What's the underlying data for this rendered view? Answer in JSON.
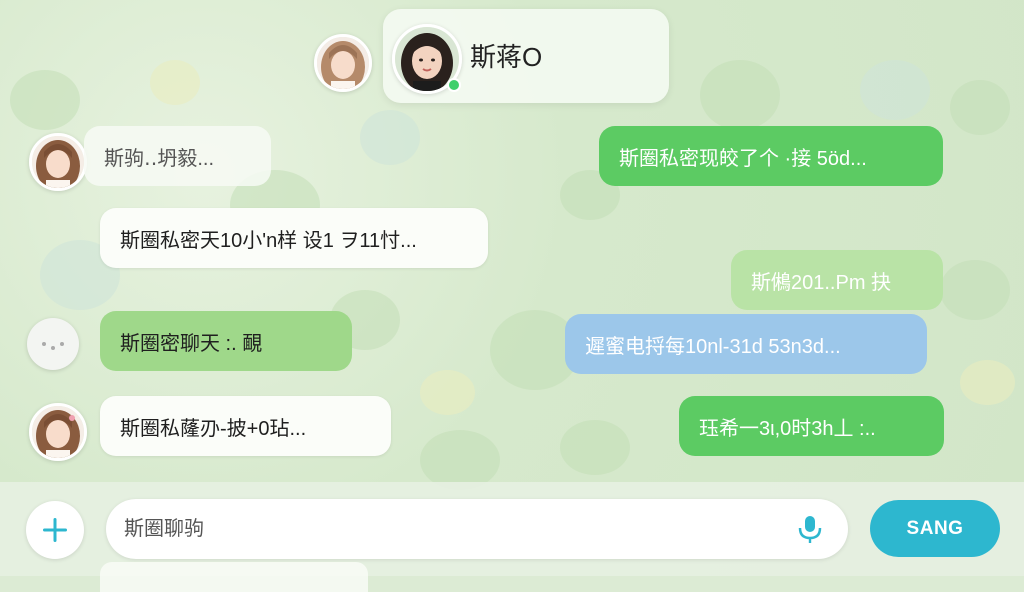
{
  "contact": {
    "name": "斯蒋O"
  },
  "messages": [
    {
      "side": "left",
      "text": "斯驹‥坍毅..."
    },
    {
      "side": "right",
      "text": "斯圈私密现皎了个 ·接 5öd..."
    },
    {
      "side": "left",
      "text": "斯圈私密天10小'n样 设1 ヲ11忖..."
    },
    {
      "side": "right",
      "text": "斯鵂201..Pm 抉"
    },
    {
      "side": "left",
      "text": "斯圈密聊天 :. 靦"
    },
    {
      "side": "right",
      "text": "遲蜜电捋每10nl-31d 53n3d..."
    },
    {
      "side": "left",
      "text": "斯圈私蕯刅-披+0玷..."
    },
    {
      "side": "right",
      "text": "珏希一3ι,0时3h丄 :.."
    }
  ],
  "composer": {
    "placeholder": "斯圈聊驹",
    "send_label": "SANG"
  },
  "colors": {
    "bubble_green_bright": "#5ccb63",
    "bubble_green_soft": "#9fd88a",
    "bubble_blue": "#9cc7ea",
    "send_button": "#2db7cf",
    "online_status": "#3fcf6b"
  },
  "icons": {
    "attach": "plus-icon",
    "voice": "microphone-icon"
  }
}
